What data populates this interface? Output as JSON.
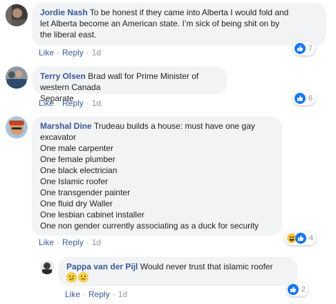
{
  "comments": [
    {
      "author": "Jordie Nash",
      "lines": [
        "To be honest if they came into Alberta I would fold and",
        "let Alberta become an American state. I’m sick of being shit on by",
        "the liberal east."
      ],
      "like_label": "Like",
      "reply_label": "Reply",
      "time": "1d",
      "reaction_count": "7",
      "reactions": [
        "like-icon"
      ],
      "avatar_icon": "avatar-photo-icon"
    },
    {
      "author": "Terry Olsen",
      "lines": [
        "Brad wall for Prime Minister of western Canada",
        "Separate"
      ],
      "like_label": "Like",
      "reply_label": "Reply",
      "time": "1d",
      "reaction_count": "6",
      "reactions": [
        "like-icon"
      ],
      "avatar_icon": "avatar-photo-icon"
    },
    {
      "author": "Marshal Dine",
      "lines": [
        "Trudeau builds a house: must have one gay",
        "excavator",
        "One male carpenter",
        "One female plumber",
        "One black electrician",
        "One Islamic roofer",
        "One transgender painter",
        "One fluid dry Waller",
        "One lesbian cabinet installer",
        "One non gender currently associating as a duck for security"
      ],
      "like_label": "Like",
      "reply_label": "Reply",
      "time": "1d",
      "reaction_count": "4",
      "reactions": [
        "haha-icon",
        "like-icon"
      ],
      "avatar_icon": "avatar-photo-icon"
    },
    {
      "author": "Pappa van der Pijl",
      "lines": [
        "Would never trust that islamic roofer"
      ],
      "emojis": [
        "confused-face-icon",
        "confused-face-icon"
      ],
      "like_label": "Like",
      "reply_label": "Reply",
      "time": "1d",
      "reaction_count": "2",
      "reactions": [
        "like-icon"
      ],
      "avatar_icon": "avatar-photo-icon"
    }
  ],
  "colors": {
    "author": "#385898",
    "bubble": "#f2f3f5",
    "like": "#1877f2",
    "meta": "#90949c"
  }
}
